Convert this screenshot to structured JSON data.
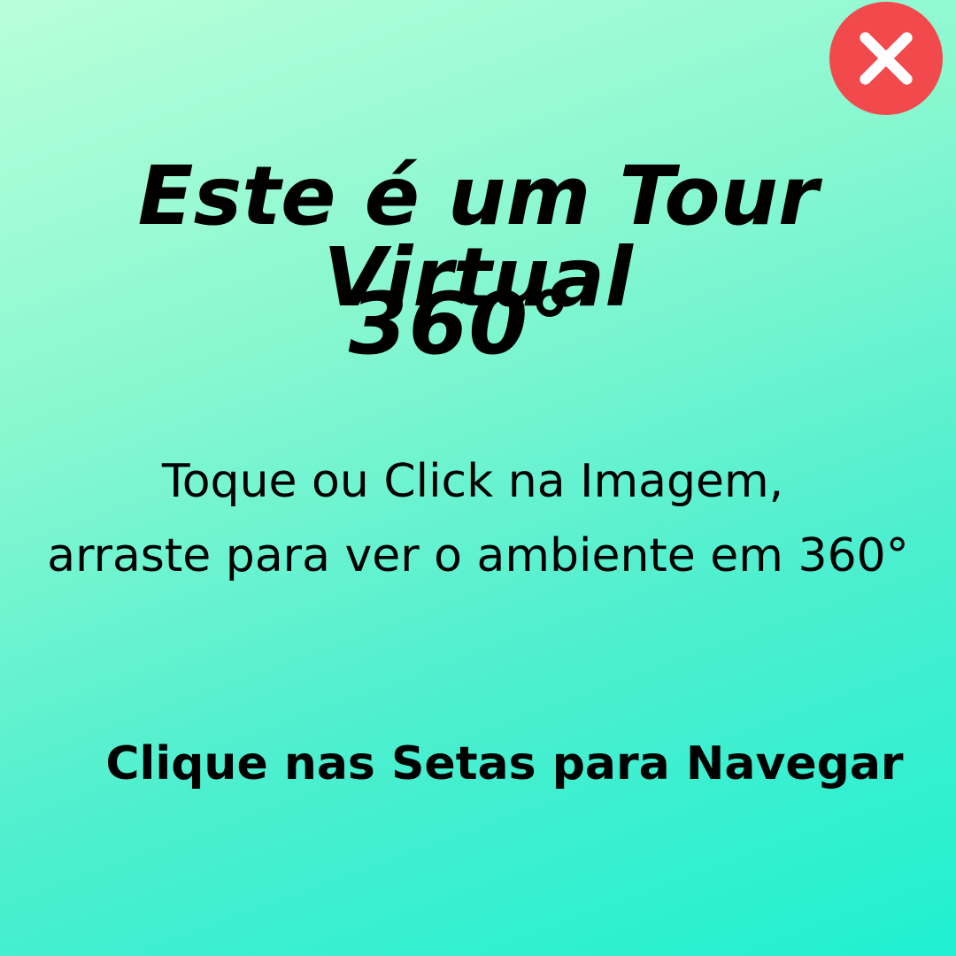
{
  "header": {
    "close_icon": "close-icon",
    "close_color": "#f2494c"
  },
  "headline": {
    "line1": "Este é um Tour Virtual",
    "line2": "360°"
  },
  "instruction": {
    "line1": "Toque ou Click na Imagem,",
    "line2": "arraste para ver o ambiente em 360°"
  },
  "navigation_hint": "Clique nas Setas para Navegar",
  "colors": {
    "background_start": "#b8ffd9",
    "background_end": "#1ff0d0",
    "text": "#000000"
  }
}
